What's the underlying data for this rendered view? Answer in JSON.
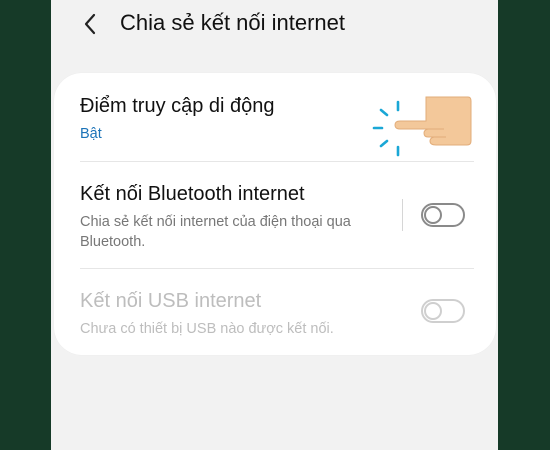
{
  "appbar": {
    "title": "Chia sẻ kết nối internet",
    "back_icon": "chevron-left-icon"
  },
  "settings": [
    {
      "key": "hotspot",
      "title": "Điểm truy cập di động",
      "subtitle": "Bật",
      "subtitle_color": "#1b73b8",
      "has_toggle": false,
      "enabled": true
    },
    {
      "key": "bluetooth",
      "title": "Kết nối Bluetooth internet",
      "subtitle": "Chia sẻ kết nối internet của điện thoại qua Bluetooth.",
      "has_toggle": true,
      "toggle_on": false,
      "enabled": true
    },
    {
      "key": "usb",
      "title": "Kết nối USB internet",
      "subtitle": "Chưa có thiết bị USB nào được kết nối.",
      "has_toggle": true,
      "toggle_on": false,
      "enabled": false
    }
  ],
  "overlay": {
    "icon": "tap-hand-icon",
    "skin_color": "#f3c89a",
    "tap_color": "#1aa7d6"
  },
  "colors": {
    "background": "#163a28",
    "screen": "#f2f2f2",
    "card": "#ffffff"
  }
}
